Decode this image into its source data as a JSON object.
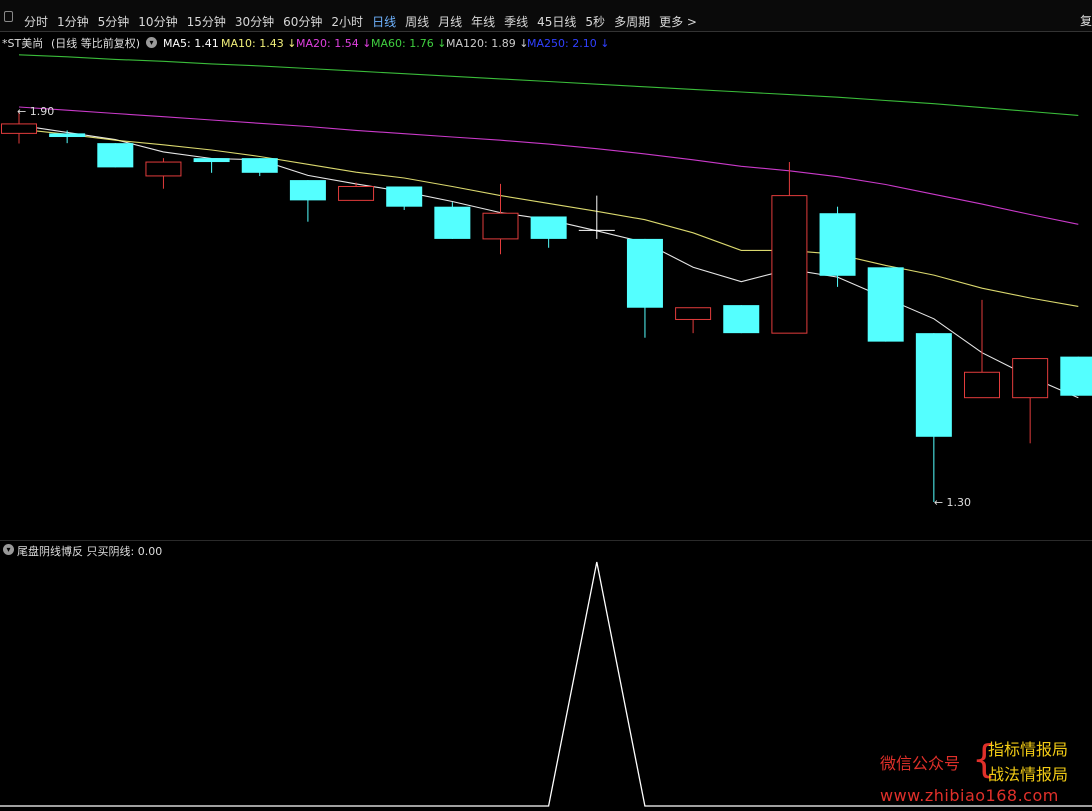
{
  "toolbar": {
    "tabs": [
      "分时",
      "1分钟",
      "5分钟",
      "10分钟",
      "15分钟",
      "30分钟",
      "60分钟",
      "2小时",
      "日线",
      "周线",
      "月线",
      "年线",
      "季线",
      "45日线",
      "5秒",
      "多周期",
      "更多 >"
    ],
    "active_tab": "日线",
    "right_edge_label": "复"
  },
  "info": {
    "security": "*ST美尚",
    "mode": "(日线 等比前复权)",
    "ma": [
      {
        "label": "MA5: 1.41",
        "color": "#ffffff",
        "arrow": ""
      },
      {
        "label": "MA10: 1.43",
        "color": "#f2f07a",
        "arrow": "↓"
      },
      {
        "label": "MA20: 1.54",
        "color": "#e040e0",
        "arrow": "↓"
      },
      {
        "label": "MA60: 1.76",
        "color": "#40d040",
        "arrow": "↓"
      },
      {
        "label": "MA120: 1.89",
        "color": "#cccccc",
        "arrow": "↓"
      },
      {
        "label": "MA250: 2.10",
        "color": "#3040ff",
        "arrow": "↓"
      }
    ],
    "up_color": "#e23c3c",
    "down_color": "#54ffff"
  },
  "indicator": {
    "title": "尾盘阴线博反",
    "value_label": "只买阴线: 0.00"
  },
  "chart_data": [
    {
      "type": "candlestick",
      "high_label": "1.90",
      "low_label": "1.30",
      "x": [
        1,
        2,
        3,
        4,
        5,
        6,
        7,
        8,
        9,
        10,
        11,
        12,
        13,
        14,
        15,
        16,
        17,
        18,
        19,
        20,
        21,
        22,
        23
      ],
      "candles": [
        {
          "open": 1.8655,
          "close": 1.88,
          "high": 1.9,
          "low": 1.85
        },
        {
          "open": 1.8655,
          "close": 1.8599,
          "high": 1.87,
          "low": 1.8505
        },
        {
          "open": 1.8505,
          "close": 1.8133,
          "high": 1.8505,
          "low": 1.8133
        },
        {
          "open": 1.8002,
          "close": 1.8215,
          "high": 1.8275,
          "low": 1.7806
        },
        {
          "open": 1.8275,
          "close": 1.8215,
          "high": 1.8275,
          "low": 1.805
        },
        {
          "open": 1.8275,
          "close": 1.805,
          "high": 1.8275,
          "low": 1.8
        },
        {
          "open": 1.7938,
          "close": 1.7627,
          "high": 1.7938,
          "low": 1.73
        },
        {
          "open": 1.7627,
          "close": 1.784,
          "high": 1.79,
          "low": 1.7627
        },
        {
          "open": 1.784,
          "close": 1.753,
          "high": 1.784,
          "low": 1.748
        },
        {
          "open": 1.753,
          "close": 1.7036,
          "high": 1.76,
          "low": 1.7036
        },
        {
          "open": 1.7036,
          "close": 1.743,
          "high": 1.788,
          "low": 1.68
        },
        {
          "open": 1.738,
          "close": 1.7036,
          "high": 1.738,
          "low": 1.69
        },
        {
          "open": 1.7167,
          "close": 1.7167,
          "high": 1.77,
          "low": 1.7036
        },
        {
          "open": 1.7036,
          "close": 1.598,
          "high": 1.7036,
          "low": 1.552
        },
        {
          "open": 1.58,
          "close": 1.598,
          "high": 1.598,
          "low": 1.559
        },
        {
          "open": 1.602,
          "close": 1.559,
          "high": 1.602,
          "low": 1.559
        },
        {
          "open": 1.559,
          "close": 1.77,
          "high": 1.8215,
          "low": 1.559
        },
        {
          "open": 1.743,
          "close": 1.647,
          "high": 1.753,
          "low": 1.63
        },
        {
          "open": 1.66,
          "close": 1.546,
          "high": 1.66,
          "low": 1.546
        },
        {
          "open": 1.559,
          "close": 1.4,
          "high": 1.559,
          "low": 1.3
        },
        {
          "open": 1.46,
          "close": 1.499,
          "high": 1.61,
          "low": 1.46
        },
        {
          "open": 1.46,
          "close": 1.52,
          "high": 1.52,
          "low": 1.39
        },
        {
          "open": 1.523,
          "close": 1.463,
          "high": 1.523,
          "low": 1.463
        }
      ],
      "ma_series": [
        {
          "name": "MA5",
          "color": "#ffffff",
          "values": [
            1.878,
            1.867,
            1.856,
            1.837,
            1.827,
            1.825,
            1.801,
            1.788,
            1.776,
            1.761,
            1.744,
            1.733,
            1.716,
            1.698,
            1.66,
            1.638,
            1.657,
            1.645,
            1.613,
            1.581,
            1.529,
            1.492,
            1.46
          ]
        },
        {
          "name": "MA10",
          "color": "#f2f07a",
          "values": [
            1.872,
            1.864,
            1.855,
            1.848,
            1.84,
            1.83,
            1.818,
            1.806,
            1.797,
            1.784,
            1.77,
            1.758,
            1.746,
            1.733,
            1.713,
            1.686,
            1.686,
            1.68,
            1.663,
            1.648,
            1.628,
            1.613,
            1.6
          ]
        },
        {
          "name": "MA20",
          "color": "#e040e0",
          "values": [
            1.906,
            1.901,
            1.896,
            1.891,
            1.886,
            1.881,
            1.876,
            1.87,
            1.865,
            1.86,
            1.855,
            1.849,
            1.842,
            1.834,
            1.825,
            1.815,
            1.808,
            1.799,
            1.787,
            1.772,
            1.757,
            1.741,
            1.726
          ]
        },
        {
          "name": "MA60",
          "color": "#40d040",
          "values": [
            1.986,
            1.983,
            1.979,
            1.976,
            1.972,
            1.969,
            1.965,
            1.961,
            1.957,
            1.953,
            1.949,
            1.945,
            1.941,
            1.937,
            1.933,
            1.929,
            1.925,
            1.921,
            1.916,
            1.911,
            1.905,
            1.899,
            1.893
          ]
        }
      ],
      "ylim": [
        1.257,
        1.9934
      ]
    },
    {
      "type": "line",
      "name": "只买阴线",
      "x": [
        1,
        2,
        3,
        4,
        5,
        6,
        7,
        8,
        9,
        10,
        11,
        12,
        13,
        14,
        15,
        16,
        17,
        18,
        19,
        20,
        21,
        22,
        23
      ],
      "values": [
        0,
        0,
        0,
        0,
        0,
        0,
        0,
        0,
        0,
        0,
        0,
        0,
        1,
        0,
        0,
        0,
        0,
        0,
        0,
        0,
        0,
        0,
        0
      ],
      "ylim": [
        0,
        1
      ]
    }
  ]
}
